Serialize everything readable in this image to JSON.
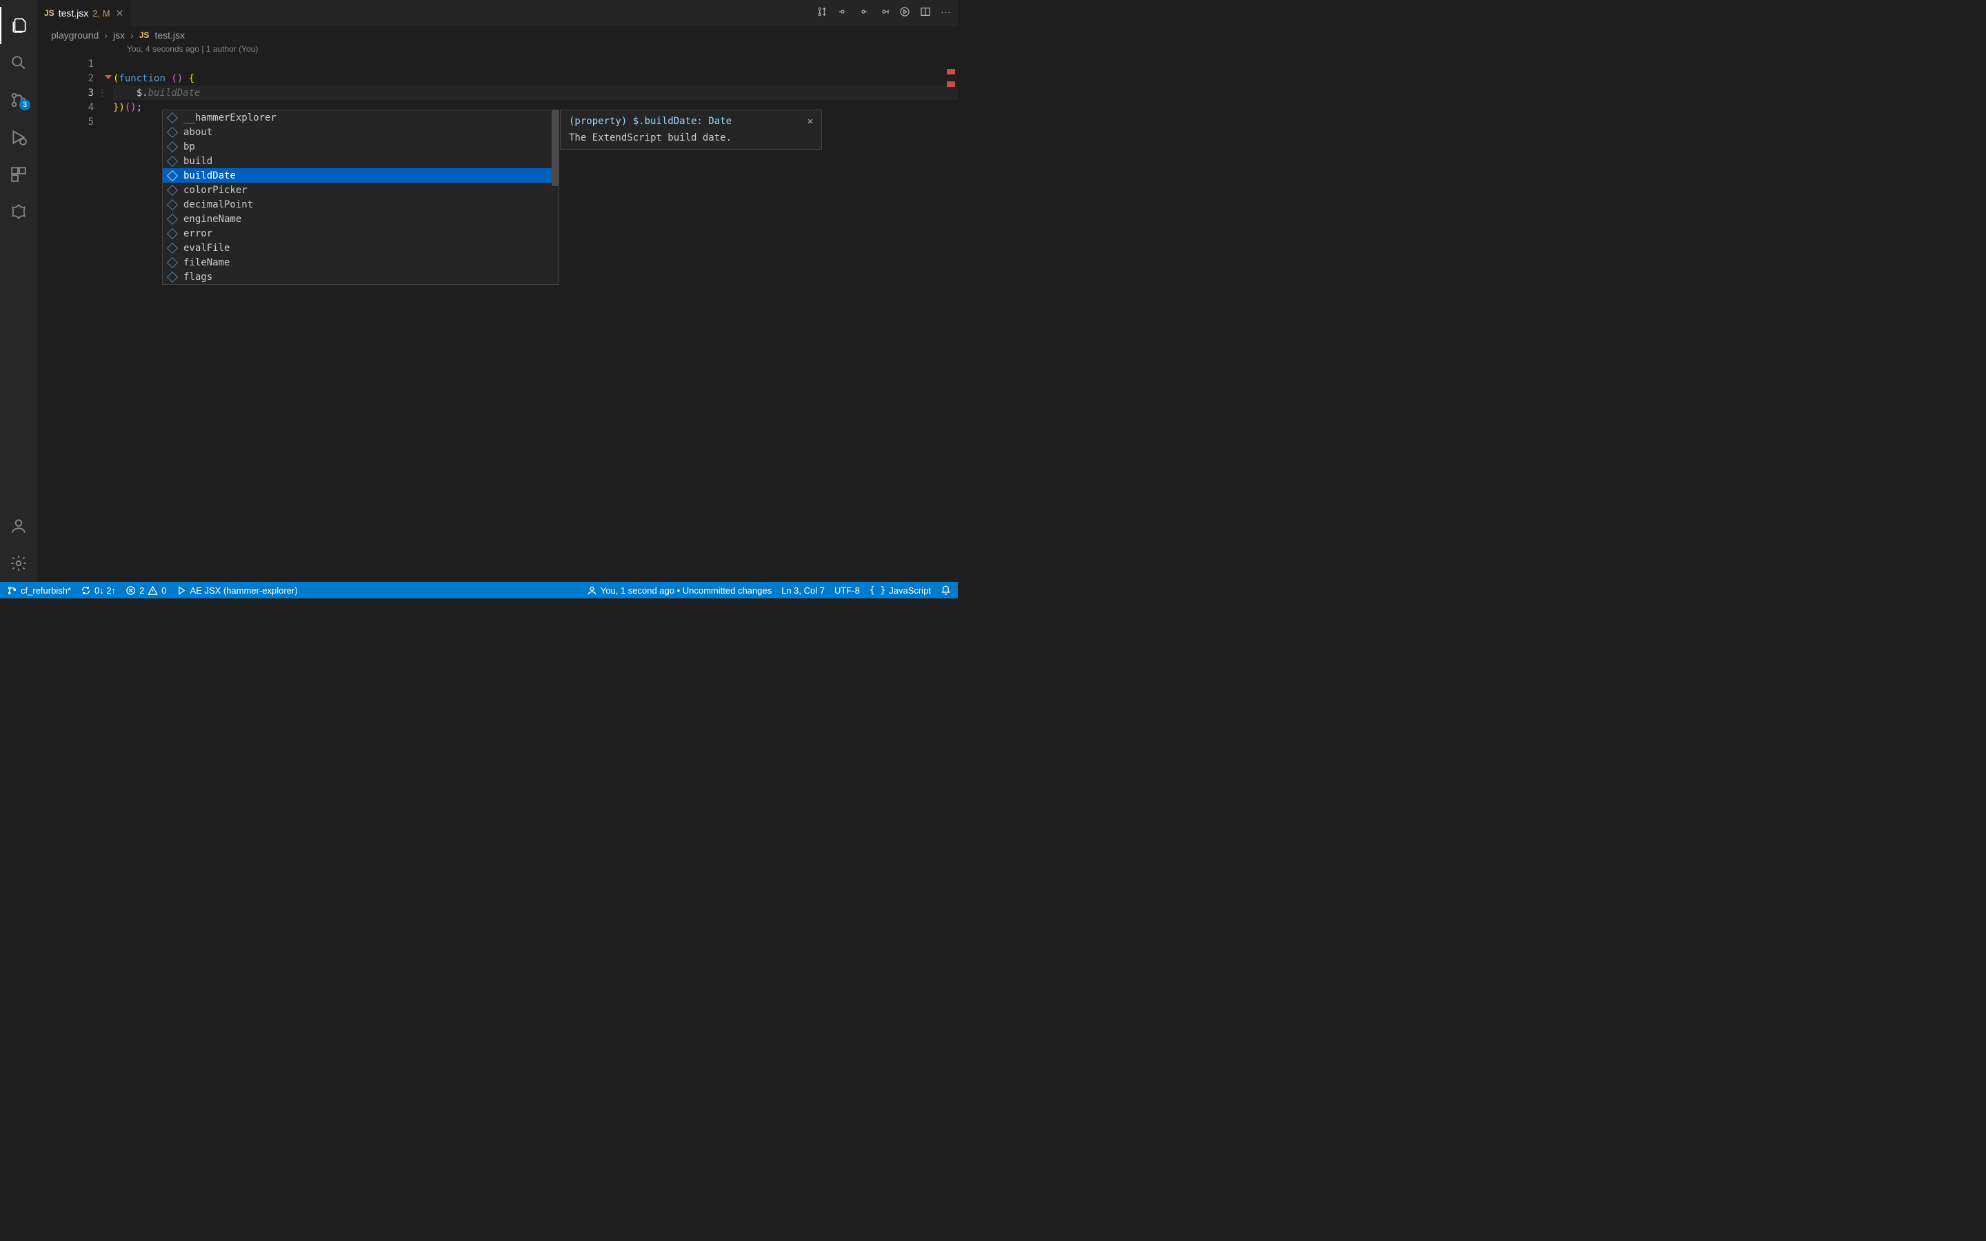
{
  "activity": {
    "source_control_badge": "3"
  },
  "tab": {
    "icon_text": "JS",
    "name": "test.jsx",
    "status": "2, M"
  },
  "breadcrumb": {
    "parts": [
      "playground",
      "jsx"
    ],
    "file_icon": "JS",
    "file": "test.jsx"
  },
  "codelens": {
    "text": "You, 4 seconds ago | 1 author (You)"
  },
  "lines": [
    {
      "num": "1",
      "code": ""
    },
    {
      "num": "2",
      "code_html": "(function () {"
    },
    {
      "num": "3",
      "code_html": "    $.buildDate"
    },
    {
      "num": "4",
      "code_html": "})();"
    },
    {
      "num": "5",
      "code": ""
    }
  ],
  "suggest": {
    "items": [
      "__hammerExplorer",
      "about",
      "bp",
      "build",
      "buildDate",
      "colorPicker",
      "decimalPoint",
      "engineName",
      "error",
      "evalFile",
      "fileName",
      "flags"
    ],
    "selected_index": 4
  },
  "doc": {
    "header": "(property) $.buildDate: Date",
    "body": "The ExtendScript build date."
  },
  "status": {
    "branch": "cf_refurbish*",
    "sync": "0↓ 2↑",
    "errors": "2",
    "warnings": "0",
    "runner": "AE JSX (hammer-explorer)",
    "blame": "You, 1 second ago • Uncommitted changes",
    "position": "Ln 3, Col 7",
    "encoding": "UTF-8",
    "language": "JavaScript"
  }
}
